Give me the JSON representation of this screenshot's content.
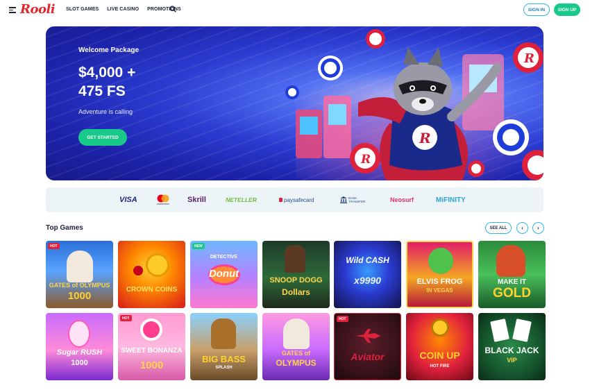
{
  "header": {
    "logo": "Rooli",
    "nav": [
      "SLOT GAMES",
      "LIVE CASINO",
      "PROMOTIONS"
    ],
    "sign_in": "SIGN IN",
    "sign_up": "SIGN UP"
  },
  "hero": {
    "subtitle": "Welcome Package",
    "title_line1": "$4,000 +",
    "title_line2": "475 FS",
    "tagline": "Adventure is calling",
    "cta": "GET STARTED"
  },
  "payments": [
    "VISA",
    "mastercard",
    "Skrill",
    "NETELLER",
    "paysafecard",
    "BANK TRANSFER",
    "Neosurf",
    "MiFINITY"
  ],
  "top_games": {
    "title": "Top Games",
    "see_all": "SEE ALL",
    "prev": "‹",
    "next": "›",
    "row1": [
      {
        "name": "GATES of OLYMPUS",
        "sub": "1000",
        "badge": "HOT"
      },
      {
        "name": "CROWN COINS",
        "sub": "",
        "badge": ""
      },
      {
        "name": "Donut",
        "sub": "DETECTIVE",
        "badge": "NEW"
      },
      {
        "name": "SNOOP DOGG",
        "sub": "Dollars",
        "badge": ""
      },
      {
        "name": "Wild CASH",
        "sub": "x9990",
        "badge": ""
      },
      {
        "name": "ELVIS FROG",
        "sub": "IN VEGAS",
        "badge": ""
      },
      {
        "name": "MAKE IT",
        "sub": "GOLD",
        "badge": ""
      }
    ],
    "row2": [
      {
        "name": "Sugar RUSH",
        "sub": "1000",
        "badge": ""
      },
      {
        "name": "SWEET BONANZA",
        "sub": "1000",
        "badge": "HOT"
      },
      {
        "name": "BIG BASS",
        "sub": "SPLASH",
        "badge": ""
      },
      {
        "name": "GATES of",
        "sub": "OLYMPUS",
        "badge": ""
      },
      {
        "name": "Aviator",
        "sub": "",
        "badge": "HOT"
      },
      {
        "name": "COIN UP",
        "sub": "HOT FIRE",
        "badge": ""
      },
      {
        "name": "BLACK JACK",
        "sub": "VIP",
        "badge": ""
      }
    ]
  }
}
